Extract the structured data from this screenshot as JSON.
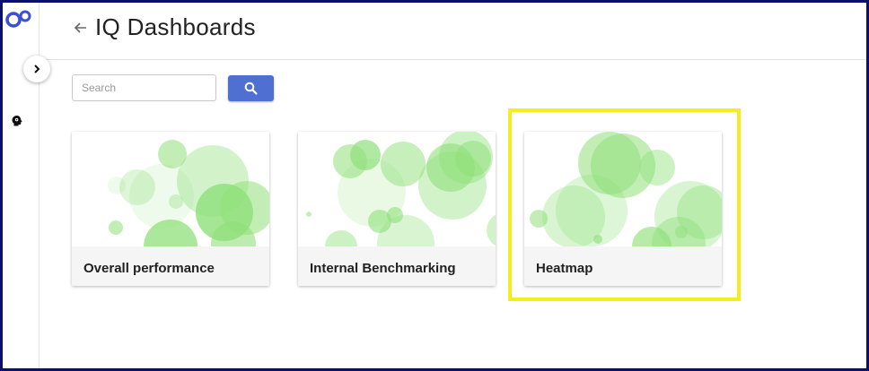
{
  "app": {
    "title": "IQ Dashboards"
  },
  "header": {
    "back_icon": "arrow-left-icon"
  },
  "sidebar": {
    "logo_icon": "app-logo-icon",
    "expand_icon": "chevron-right-icon",
    "items": [
      {
        "icon": "brain-icon"
      }
    ]
  },
  "search": {
    "placeholder": "Search",
    "value": "",
    "button_icon": "search-icon"
  },
  "cards": [
    {
      "label": "Overall performance"
    },
    {
      "label": "Internal Benchmarking"
    },
    {
      "label": "Heatmap",
      "highlighted": true
    }
  ],
  "colors": {
    "accent": "#4f6fd3",
    "bubble_green": "#8fe07a",
    "highlight": "#f5ee1f",
    "border": "#0b0f6e"
  }
}
